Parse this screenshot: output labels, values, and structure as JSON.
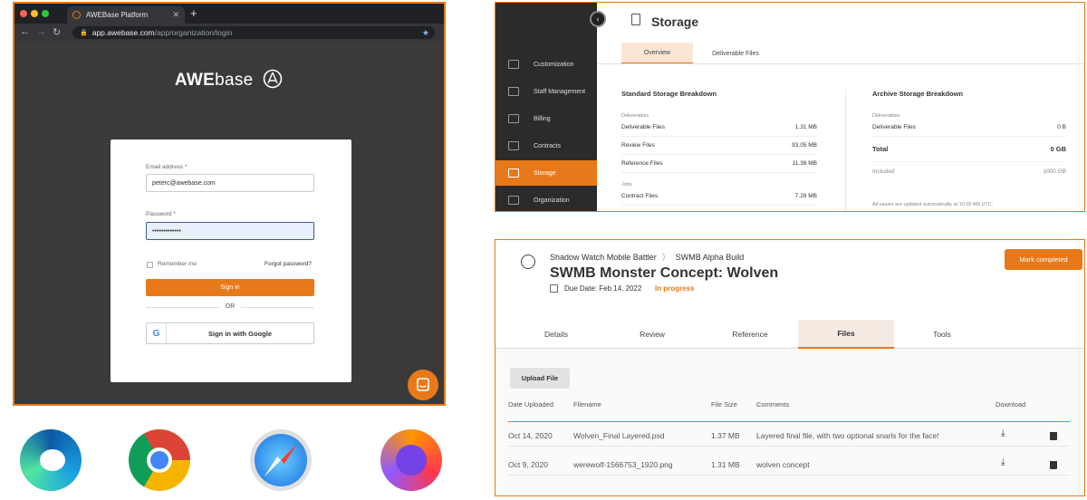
{
  "colors": {
    "accent": "#e8791a",
    "dark_bg": "#3a3a3a",
    "sidebar_bg": "#2b2b2b"
  },
  "browser": {
    "tab_title": "AWEBase Platform",
    "new_tab": "+",
    "url_host": "app.awebase.com",
    "url_path": "/app/organization/login"
  },
  "login": {
    "logo_bold": "AWE",
    "logo_thin": "base",
    "email_label": "Email address *",
    "email_value": "peterc@awebase.com",
    "password_label": "Password *",
    "password_value": "•••••••••••••",
    "remember_me": "Remember me",
    "forgot_password": "Forgot password?",
    "sign_in": "Sign in",
    "or": "OR",
    "google_letter": "G",
    "sign_in_google": "Sign in with Google"
  },
  "browser_icons": [
    "edge-icon",
    "chrome-icon",
    "safari-icon",
    "firefox-icon"
  ],
  "storage": {
    "title": "Storage",
    "sidebar": [
      {
        "label": "Customization",
        "icon": "customization-icon"
      },
      {
        "label": "Staff Management",
        "icon": "staff-icon"
      },
      {
        "label": "Billing",
        "icon": "billing-icon"
      },
      {
        "label": "Contracts",
        "icon": "contracts-icon"
      },
      {
        "label": "Storage",
        "icon": "storage-icon",
        "active": true
      },
      {
        "label": "Organization",
        "icon": "organization-icon"
      }
    ],
    "tabs": [
      "Overview",
      "Deliverable Files"
    ],
    "standard": {
      "heading": "Standard Storage Breakdown",
      "group_deliverables": "Deliverables",
      "rows": [
        {
          "label": "Deliverable Files",
          "value": "1.31 MB"
        },
        {
          "label": "Review Files",
          "value": "93.05 MB"
        },
        {
          "label": "Reference Files",
          "value": "11.39 MB"
        }
      ],
      "group_jobs": "Jobs",
      "job_rows": [
        {
          "label": "Contract Files",
          "value": "7.28 MB"
        }
      ]
    },
    "archive": {
      "heading": "Archive Storage Breakdown",
      "group_deliverables": "Deliverables",
      "deliverable_label": "Deliverable Files",
      "deliverable_value": "0 B",
      "total_label": "Total",
      "total_value": "0 GB",
      "included_label": "Included",
      "included_value": "1000 GB"
    },
    "note": "All values are updated automatically at 10:00 AM UTC."
  },
  "task": {
    "breadcrumb_project": "Shadow Watch Mobile Battler",
    "breadcrumb_sep": "〉",
    "breadcrumb_build": "SWMB Alpha Build",
    "title": "SWMB Monster Concept: Wolven",
    "due": "Due Date: Feb 14, 2022",
    "status": "In progress",
    "mark_completed": "Mark completed",
    "tabs": [
      "Details",
      "Review",
      "Reference",
      "Files",
      "Tools"
    ],
    "upload": "Upload File",
    "columns": [
      "Date Uploaded",
      "Filename",
      "File Size",
      "Comments",
      "Download"
    ],
    "files": [
      {
        "date": "Oct 14, 2020",
        "name": "Wolven_Final Layered.psd",
        "size": "1.37 MB",
        "comment": "Layered final file, with two optional snarls for the face!"
      },
      {
        "date": "Oct 9, 2020",
        "name": "werewolf-1566753_1920.png",
        "size": "1.31 MB",
        "comment": "wolven concept"
      }
    ]
  }
}
